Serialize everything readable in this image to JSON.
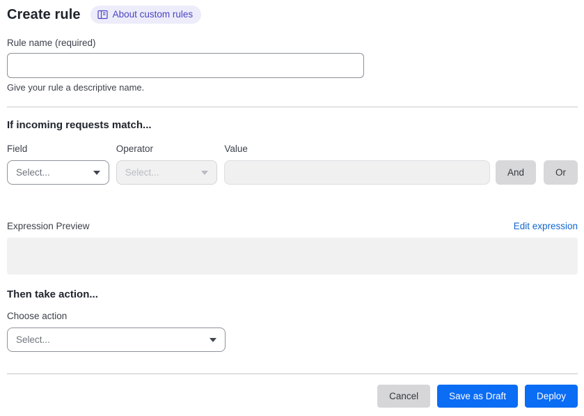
{
  "header": {
    "title": "Create rule",
    "about_badge": {
      "label": "About custom rules",
      "icon": "book-icon"
    }
  },
  "rule_name": {
    "label": "Rule name (required)",
    "value": "",
    "helper": "Give your rule a descriptive name."
  },
  "match_section": {
    "heading": "If incoming requests match...",
    "field": {
      "label": "Field",
      "selected": "Select..."
    },
    "operator": {
      "label": "Operator",
      "selected": "Select...",
      "disabled": true
    },
    "value": {
      "label": "Value",
      "value": "",
      "disabled": true
    },
    "and_button": "And",
    "or_button": "Or"
  },
  "expression": {
    "label": "Expression Preview",
    "edit_link": "Edit expression",
    "preview_content": ""
  },
  "action_section": {
    "heading": "Then take action...",
    "choose_label": "Choose action",
    "selected": "Select..."
  },
  "footer": {
    "cancel": "Cancel",
    "save_draft": "Save as Draft",
    "deploy": "Deploy"
  },
  "colors": {
    "primary_blue": "#0b6cf4",
    "link_blue": "#1066cf",
    "badge_bg": "#edecfa",
    "badge_text": "#4a43c4",
    "disabled_bg": "#f1f1f2",
    "preview_bg": "#f1f1f1"
  }
}
